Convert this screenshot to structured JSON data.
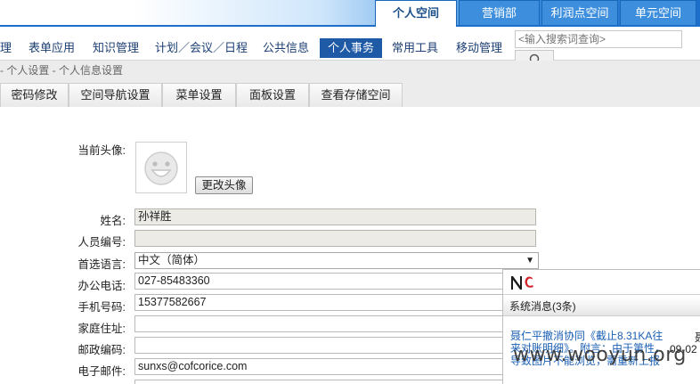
{
  "space_tabs": [
    {
      "label": "个人空间",
      "active": true
    },
    {
      "label": "营销部",
      "active": false
    },
    {
      "label": "利润点空间",
      "active": false
    },
    {
      "label": "单元空间",
      "active": false
    }
  ],
  "menu": [
    {
      "label": "理",
      "active": false
    },
    {
      "label": "表单应用",
      "active": false
    },
    {
      "label": "知识管理",
      "active": false
    },
    {
      "label": "计划／会议／日程",
      "active": false
    },
    {
      "label": "公共信息",
      "active": false
    },
    {
      "label": "个人事务",
      "active": true
    },
    {
      "label": "常用工具",
      "active": false
    },
    {
      "label": "移动管理",
      "active": false
    }
  ],
  "search": {
    "placeholder": "<输入搜索词查询>"
  },
  "breadcrumb": "- 个人设置 - 个人信息设置",
  "subtabs": [
    "密码修改",
    "空间导航设置",
    "菜单设置",
    "面板设置",
    "查看存储空间"
  ],
  "form": {
    "avatar_label": "当前头像:",
    "change_avatar_button": "更改头像",
    "name_label": "姓名:",
    "name_value": "孙祥胜",
    "employee_no_label": "人员编号:",
    "employee_no_value": "",
    "language_label": "首选语言:",
    "language_value": "中文（简体）",
    "office_phone_label": "办公电话:",
    "office_phone_value": "027-85483360",
    "mobile_label": "手机号码:",
    "mobile_value": "15377582667",
    "address_label": "家庭住址:",
    "address_value": "",
    "postcode_label": "邮政编码:",
    "postcode_value": "",
    "email_label": "电子邮件:",
    "email_value": "sunxs@cofcorice.com"
  },
  "notification": {
    "title": "系统消息(3条)",
    "message": "聂仁平撤消协同《截止8.31KA往来对账明细》。附言：由于第性，导致图片不能浏览，需重新上报",
    "side_char": "聂",
    "date": "09-02"
  },
  "watermark": "www.wooyun.org",
  "colors": {
    "accent": "#1f5aa6",
    "link": "#1a5fb4",
    "banner": "#1c6fcb"
  }
}
